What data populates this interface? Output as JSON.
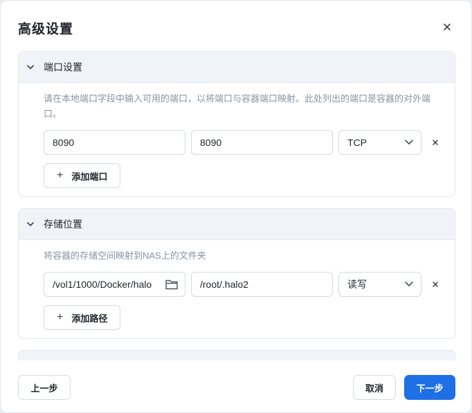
{
  "dialog": {
    "title": "高级设置"
  },
  "ports": {
    "title": "端口设置",
    "description": "请在本地端口字段中输入可用的端口，以将端口与容器端口映射。此处列出的端口是容器的对外端口。",
    "rows": [
      {
        "local_port": "8090",
        "container_port": "8090",
        "protocol": "TCP"
      }
    ],
    "add_label": "添加端口"
  },
  "storage": {
    "title": "存储位置",
    "description": "将容器的存储空间映射到NAS上的文件夹",
    "rows": [
      {
        "nas_path": "/vol1/1000/Docker/halo",
        "container_path": "/root/.halo2",
        "permission": "读写"
      }
    ],
    "add_label": "添加路径"
  },
  "footer": {
    "prev_label": "上一步",
    "cancel_label": "取消",
    "next_label": "下一步"
  },
  "colors": {
    "primary": "#1f6fe6",
    "section_header_bg": "#f0f3f8",
    "description_text": "#8a93a0"
  },
  "icons": [
    "close-icon",
    "chevron-down-icon",
    "select-arrow-icon",
    "remove-icon",
    "plus-icon",
    "folder-icon"
  ]
}
